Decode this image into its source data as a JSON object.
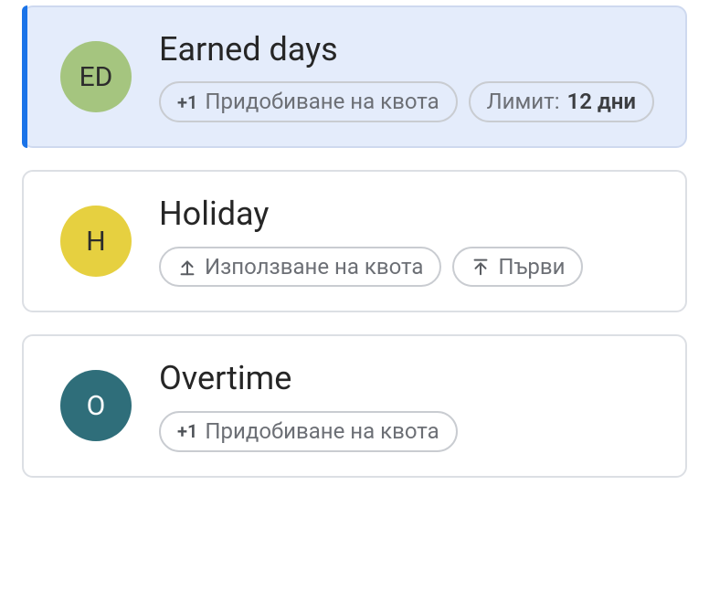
{
  "labels": {
    "acquire": "Придобиване на квота",
    "use": "Използване на квота",
    "first": "Първи",
    "limitprefix": "Лимит:",
    "plusone": "+1"
  },
  "items": [
    {
      "avatar_text": "ED",
      "avatar_bg": "#a5c57f",
      "title": "Earned days",
      "limit_value": "12 дни",
      "selected": true,
      "chips": [
        "acquire",
        "limit"
      ]
    },
    {
      "avatar_text": "H",
      "avatar_bg": "#e6d040",
      "title": "Holiday",
      "selected": false,
      "chips": [
        "use",
        "first"
      ]
    },
    {
      "avatar_text": "O",
      "avatar_bg": "#2f6e7a",
      "avatar_fg": "#ffffff",
      "title": "Overtime",
      "selected": false,
      "chips": [
        "acquire"
      ]
    }
  ]
}
